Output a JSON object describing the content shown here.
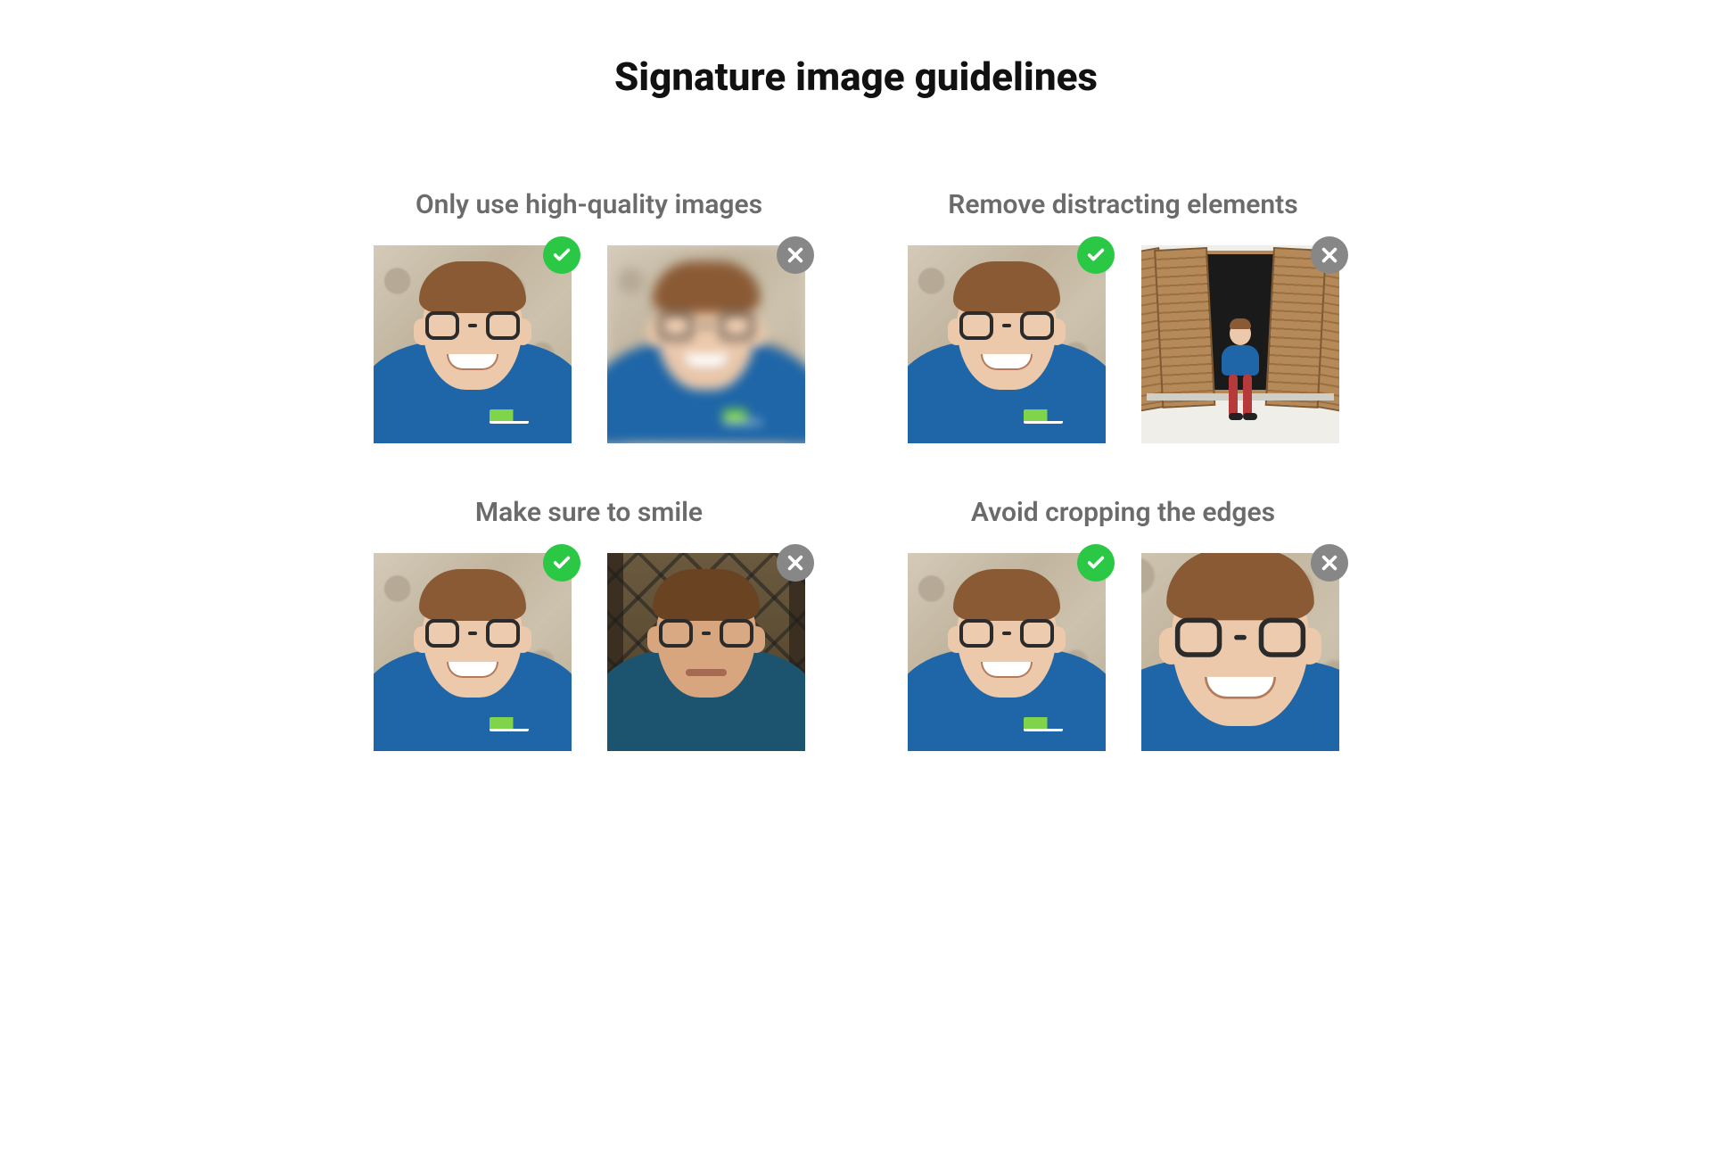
{
  "page": {
    "title": "Signature image guidelines"
  },
  "guidelines": [
    {
      "title": "Only use high-quality images",
      "good_variant": "portrait-base-smile",
      "bad_variant": "portrait-blurred-smile"
    },
    {
      "title": "Remove distracting elements",
      "good_variant": "portrait-base-smile",
      "bad_variant": "portrait-window-sitting"
    },
    {
      "title": "Make sure to smile",
      "good_variant": "portrait-base-smile",
      "bad_variant": "portrait-lattice-neutral"
    },
    {
      "title": "Avoid cropping the edges",
      "good_variant": "portrait-base-smile",
      "bad_variant": "portrait-overcropped-smile"
    }
  ],
  "icons": {
    "check": "check-icon",
    "cross": "cross-icon"
  },
  "colors": {
    "good_badge": "#2ac845",
    "bad_badge": "#878787",
    "tee": "#1e66a8",
    "title_gray": "#6b6b6b"
  }
}
